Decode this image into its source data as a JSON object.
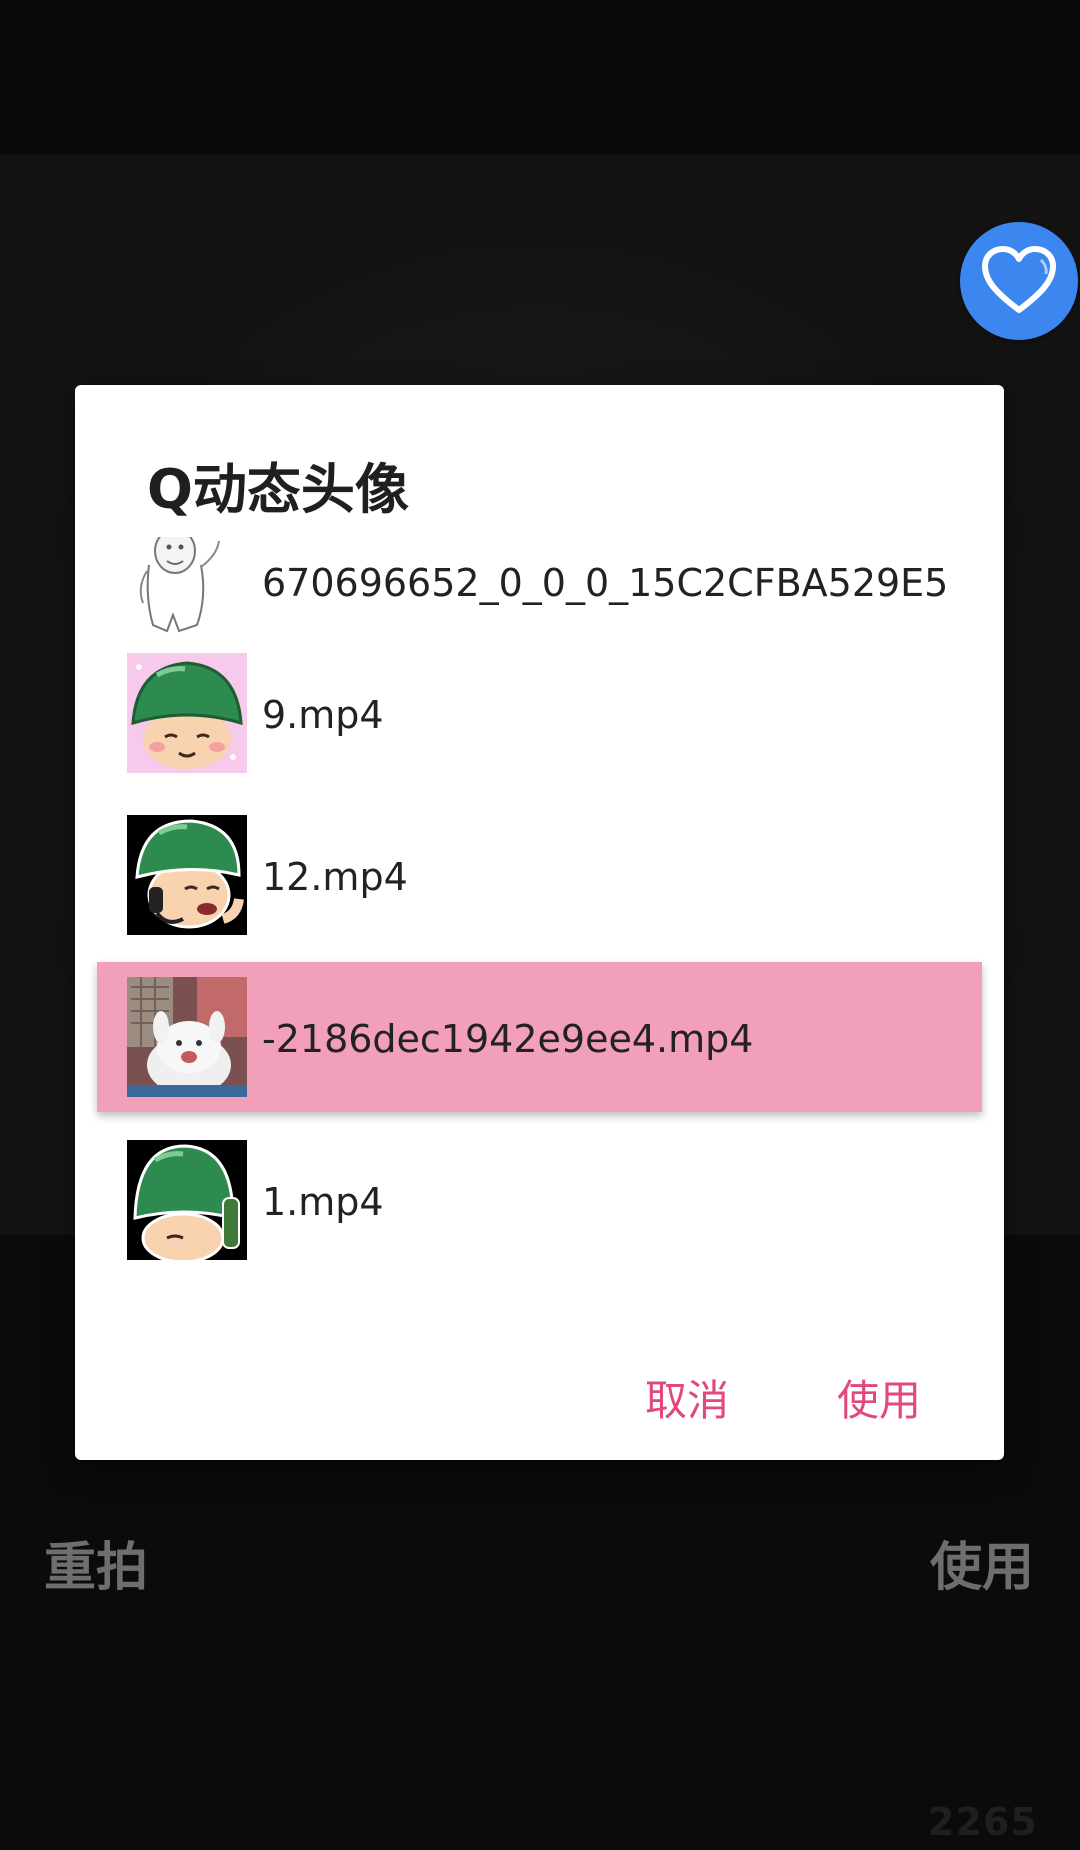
{
  "dialog": {
    "title": "Q动态头像",
    "items": [
      {
        "name": "670696652_0_0_0_15C2CFBA529E5",
        "thumb": "sketch-face-thumbnail",
        "selected": false
      },
      {
        "name": "9.mp4",
        "thumb": "green-helmet-smile-thumbnail",
        "selected": false
      },
      {
        "name": "12.mp4",
        "thumb": "green-helmet-phone-thumbnail",
        "selected": false
      },
      {
        "name": "-2186dec1942e9ee4.mp4",
        "thumb": "white-bunny-thumbnail",
        "selected": true
      },
      {
        "name": "1.mp4",
        "thumb": "green-helmet-hide-thumbnail",
        "selected": false
      }
    ],
    "cancel_label": "取消",
    "use_label": "使用"
  },
  "bottom_bar": {
    "retake_label": "重拍",
    "use_label": "使用"
  },
  "favorite_icon": "heart-icon",
  "watermark": "2265",
  "colors": {
    "accent": "#e2487c",
    "selected_row": "#f29fba",
    "fav_button": "#3b87ef",
    "helmet_green": "#2e8b4f"
  }
}
